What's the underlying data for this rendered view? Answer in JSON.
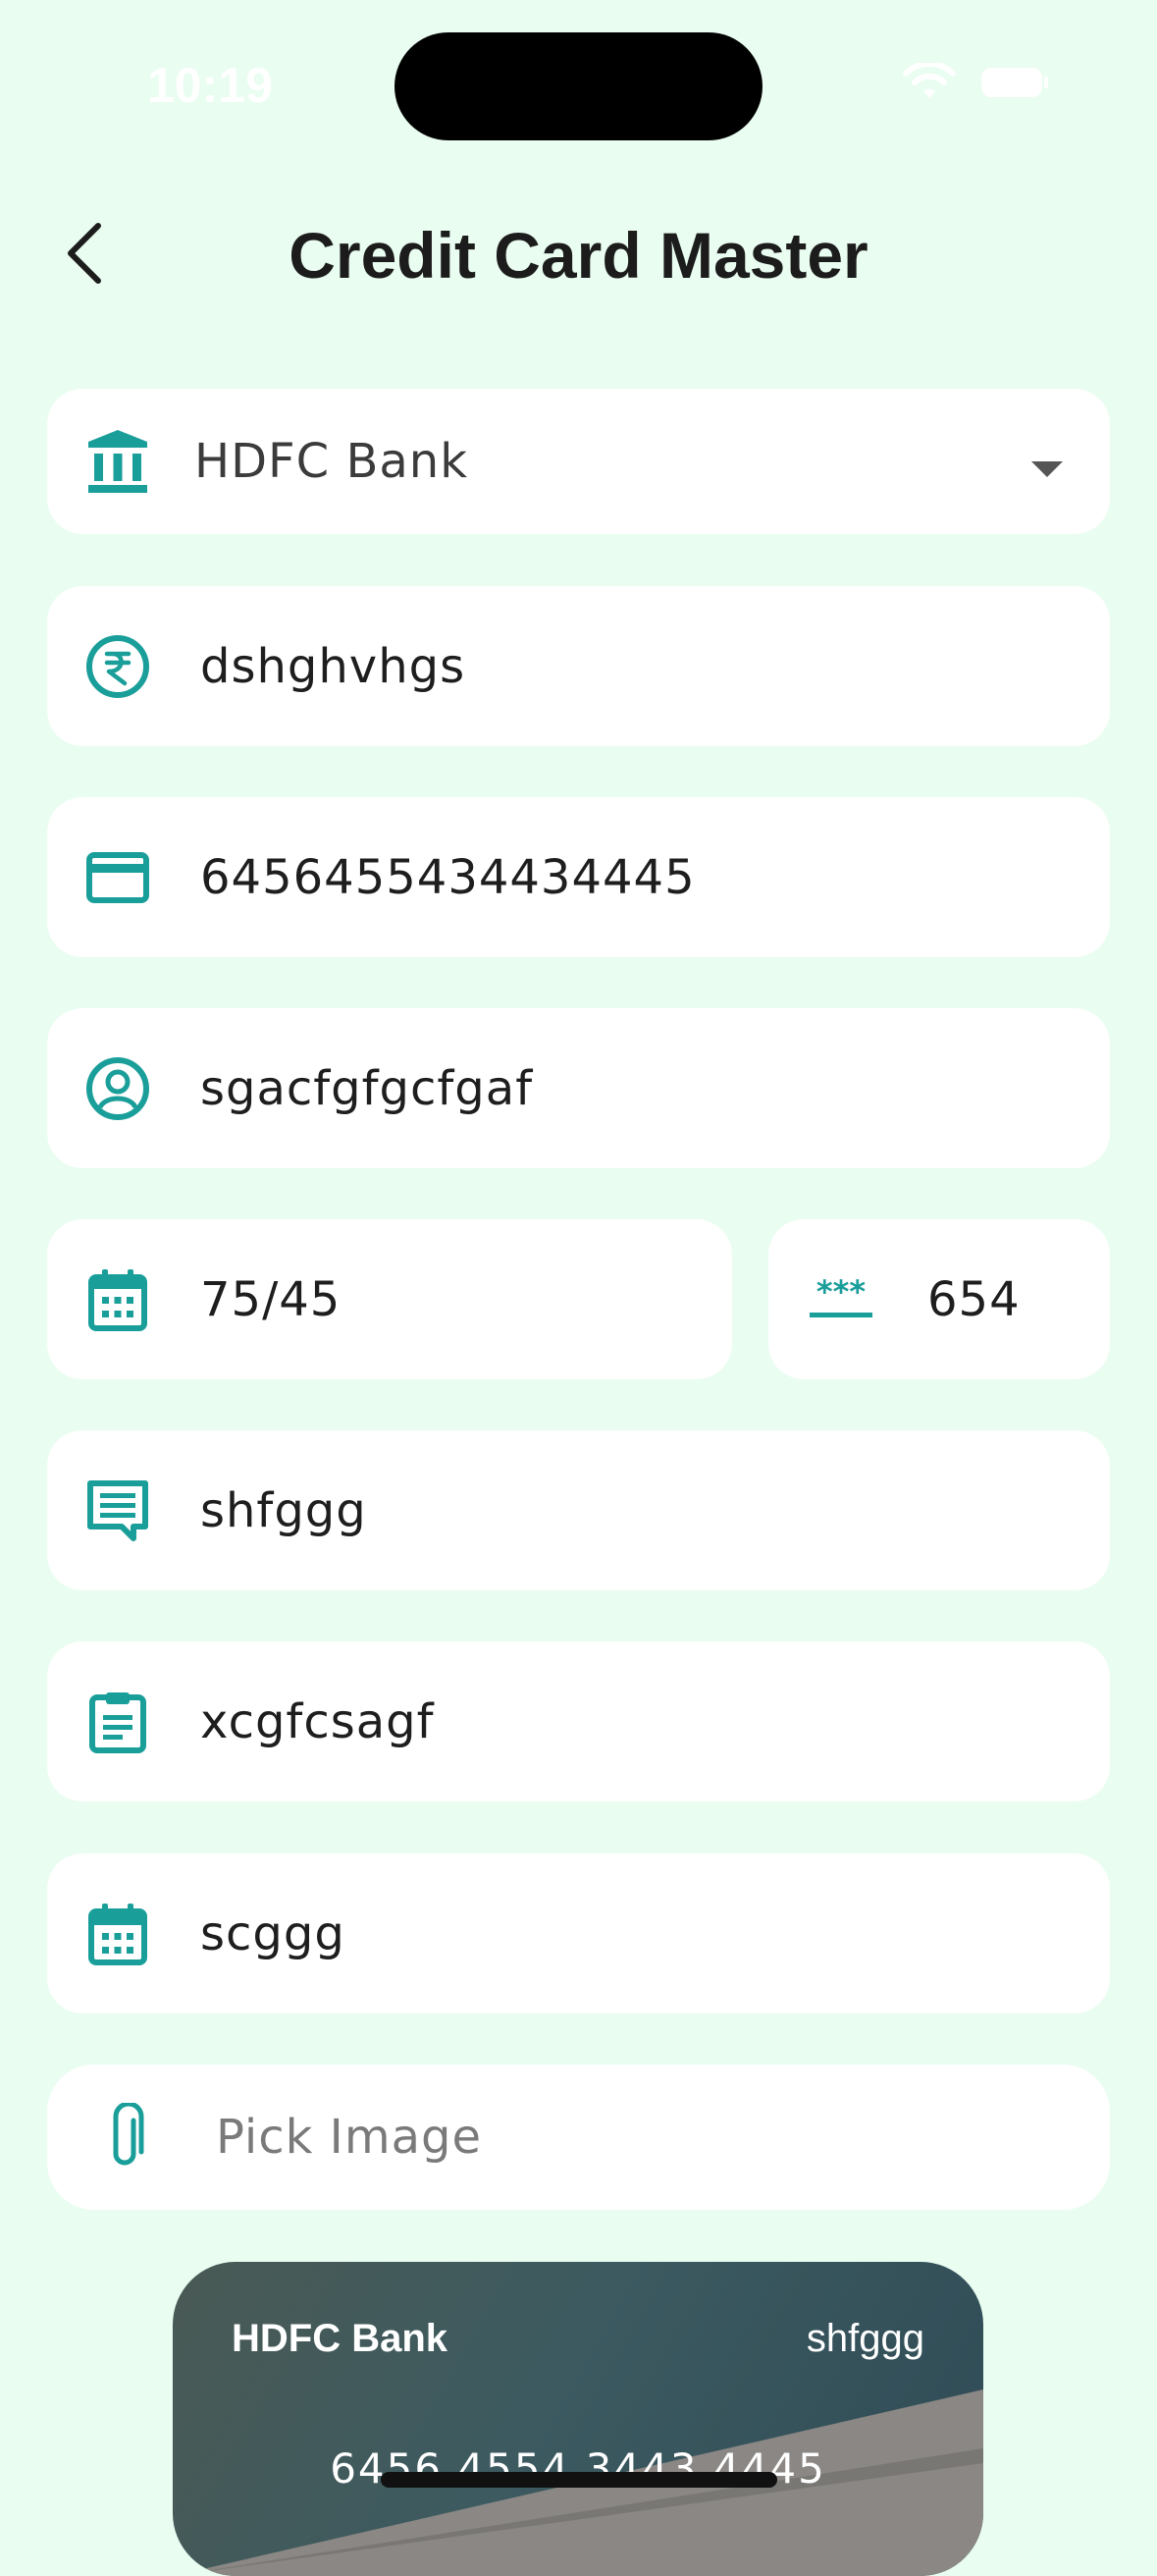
{
  "status_bar": {
    "time": "10:19"
  },
  "header": {
    "title": "Credit Card Master",
    "back_icon": "chevron-left-icon"
  },
  "form": {
    "bank": {
      "icon": "bank-icon",
      "value": "HDFC Bank"
    },
    "name": {
      "icon": "rupee-icon",
      "value": "dshghvhgs"
    },
    "card_number": {
      "icon": "credit-card-icon",
      "value": "6456455434434445"
    },
    "holder": {
      "icon": "user-circle-icon",
      "value": "sgacfgfgcfgaf"
    },
    "expiry": {
      "icon": "calendar-icon",
      "value": "75/45"
    },
    "cvv": {
      "icon": "password-icon",
      "value": "654"
    },
    "label": {
      "icon": "message-icon",
      "value": "shfggg"
    },
    "notes": {
      "icon": "clipboard-icon",
      "value": "xcgfcsagf"
    },
    "due_date": {
      "icon": "calendar-icon",
      "value": "scggg"
    },
    "image": {
      "icon": "paperclip-icon",
      "placeholder": "Pick Image"
    }
  },
  "card_preview": {
    "bank": "HDFC Bank",
    "label": "shfggg",
    "number": "6456 4554 3443 4445"
  },
  "colors": {
    "background": "#e9fdf0",
    "accent": "#1a9e9a",
    "field_bg": "#ffffff"
  }
}
